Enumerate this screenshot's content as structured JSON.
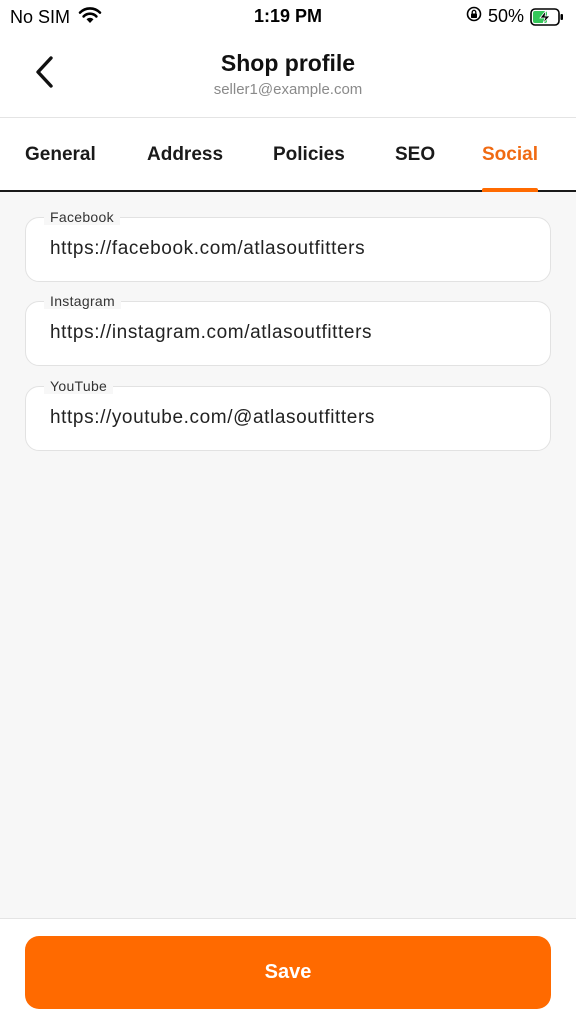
{
  "status_bar": {
    "carrier": "No SIM",
    "time": "1:19 PM",
    "battery": "50%",
    "icons": [
      "wifi-icon",
      "orientation-lock-icon",
      "battery-charging-icon"
    ]
  },
  "header": {
    "title": "Shop profile",
    "subtitle": "seller1@example.com",
    "back_icon": "chevron-left-icon"
  },
  "tabs": [
    {
      "label": "General",
      "active": false
    },
    {
      "label": "Address",
      "active": false
    },
    {
      "label": "Policies",
      "active": false
    },
    {
      "label": "SEO",
      "active": false
    },
    {
      "label": "Social",
      "active": true
    }
  ],
  "fields": [
    {
      "label": "Facebook",
      "value": "https://facebook.com/atlasoutfitters"
    },
    {
      "label": "Instagram",
      "value": "https://instagram.com/atlasoutfitters"
    },
    {
      "label": "YouTube",
      "value": "https://youtube.com/@atlasoutfitters"
    }
  ],
  "footer": {
    "save_label": "Save"
  },
  "colors": {
    "accent": "#ff6a00",
    "active_tab_text": "#f06a12",
    "background": "#f7f7f7"
  }
}
